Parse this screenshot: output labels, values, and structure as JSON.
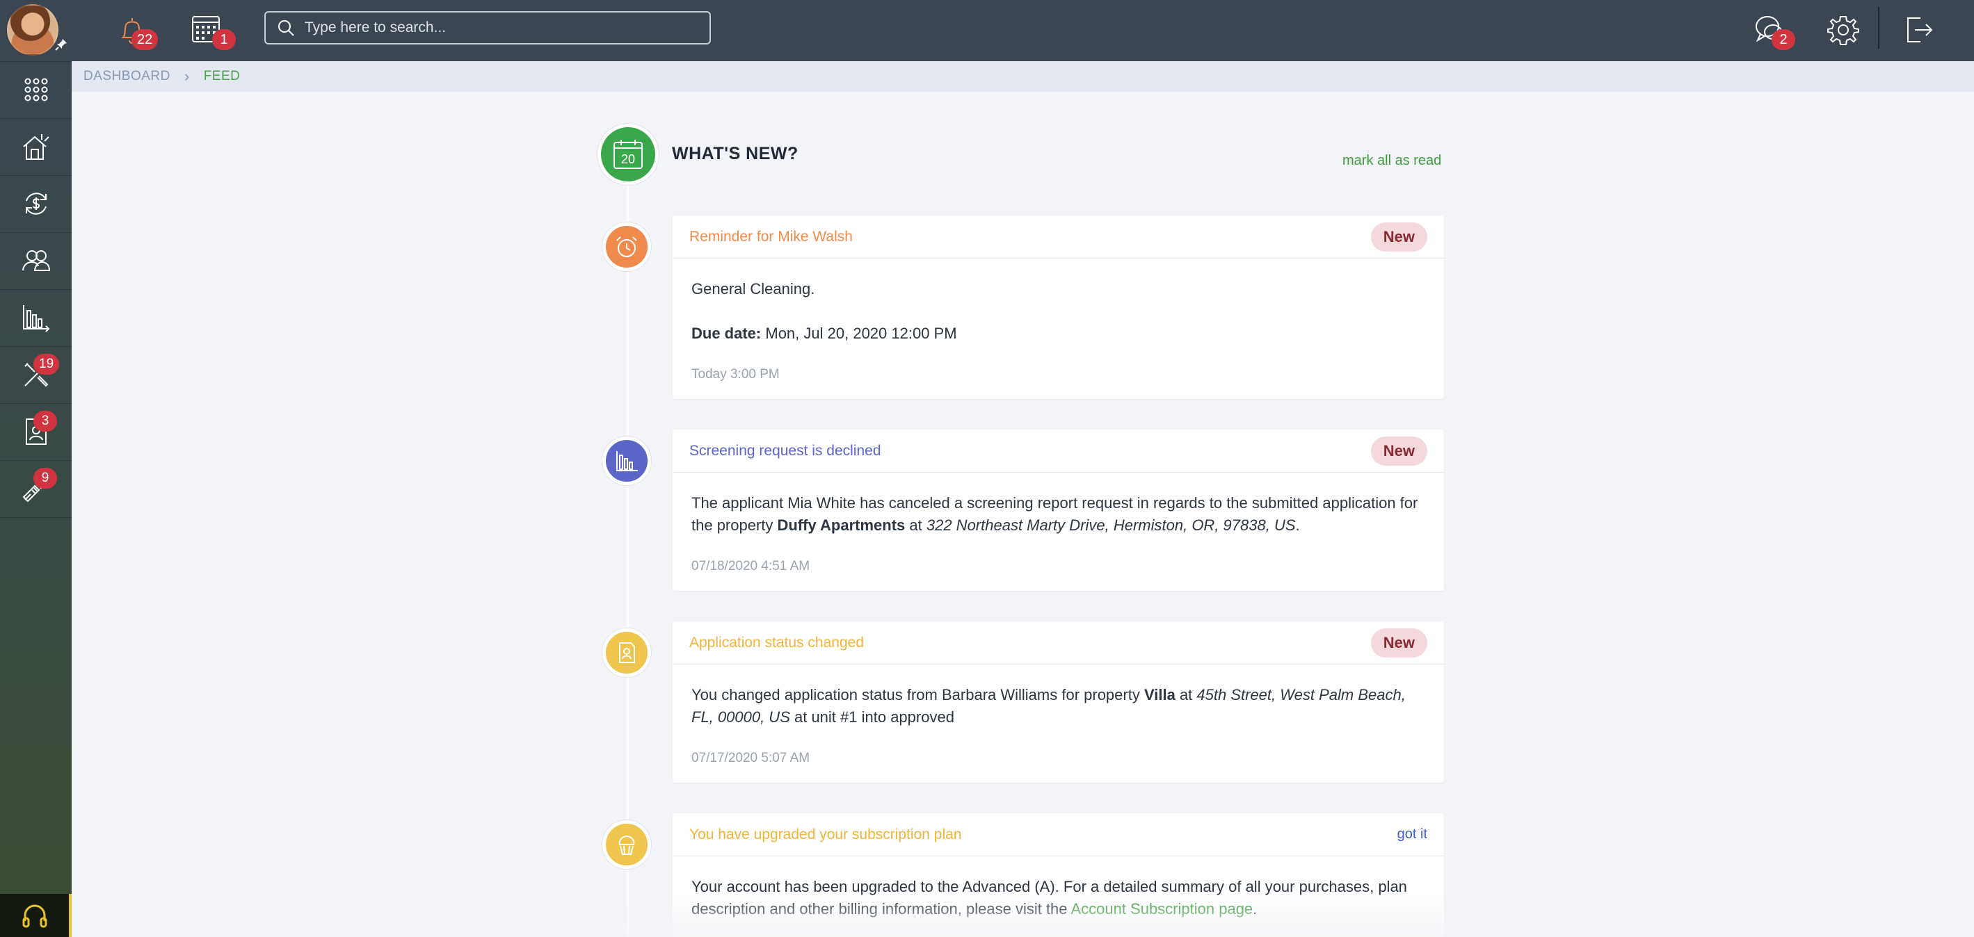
{
  "topbar": {
    "notifications_count": "22",
    "calendar_count": "1",
    "messages_count": "2",
    "search_placeholder": "Type here to search..."
  },
  "sidebar": {
    "items": [
      {
        "icon": "apps-grid-icon",
        "badge": ""
      },
      {
        "icon": "properties-icon",
        "badge": ""
      },
      {
        "icon": "payments-icon",
        "badge": ""
      },
      {
        "icon": "people-icon",
        "badge": ""
      },
      {
        "icon": "reports-icon",
        "badge": ""
      },
      {
        "icon": "maintenance-icon",
        "badge": "19"
      },
      {
        "icon": "applications-icon",
        "badge": "3"
      },
      {
        "icon": "tools-icon",
        "badge": "9"
      }
    ]
  },
  "breadcrumb": {
    "home": "DASHBOARD",
    "current": "FEED"
  },
  "feed": {
    "header_day": "20",
    "title": "WHAT'S NEW?",
    "mark_all_label": "mark all as read",
    "cards": [
      {
        "title": "Reminder for Mike Walsh",
        "title_color": "#ef8a4c",
        "status": "New",
        "line1": "General Cleaning.",
        "due_label": "Due date:",
        "due_value": "Mon, Jul 20, 2020 12:00 PM",
        "time": "Today 3:00 PM"
      },
      {
        "title": "Screening request is declined",
        "title_color": "#5b65c7",
        "status": "New",
        "text_a": "The applicant Mia White has canceled a screening report request in regards to the submitted application for the property ",
        "property": "Duffy Apartments",
        "text_b": " at ",
        "address": "322 Northeast Marty Drive, Hermiston, OR, 97838, US",
        "text_c": ".",
        "time": "07/18/2020 4:51 AM"
      },
      {
        "title": "Application status changed",
        "title_color": "#f0b43a",
        "status": "New",
        "text_a": "You changed application status from Barbara Williams for property ",
        "property": "Villa",
        "text_b": " at ",
        "address": "45th Street, West Palm Beach, FL, 00000, US",
        "text_c": " at unit #1 into approved",
        "time": "07/17/2020 5:07 AM"
      },
      {
        "title": "You have upgraded your subscription plan",
        "title_color": "#f0b43a",
        "action": "got it",
        "text_a": "Your account has been upgraded to the Advanced (A). For a detailed summary of all your purchases, plan description and other billing information, please visit the ",
        "link": "Account Subscription page",
        "text_b": "."
      }
    ]
  },
  "colors": {
    "brand_green": "#3aa84a",
    "badge_red": "#d2343f",
    "topbar_bg": "#3b4652",
    "reminder_orange": "#ef8a4c",
    "screening_purple": "#5b65c7",
    "application_yellow": "#f0c54e"
  }
}
